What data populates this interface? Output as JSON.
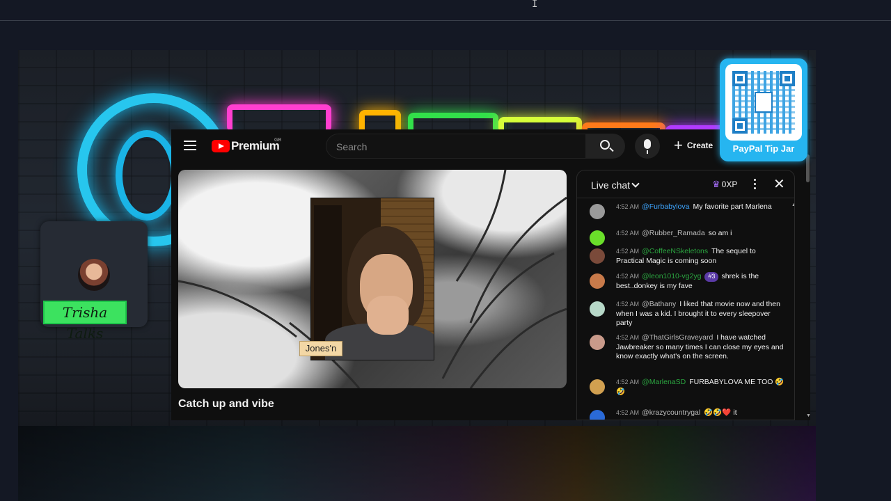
{
  "top": {
    "cursor": "I"
  },
  "overlay": {
    "avatar_name": "Trisha Talks",
    "tip_jar_label": "PayPal Tip Jar"
  },
  "youtube": {
    "brand": "Premium",
    "country": "GB",
    "search_placeholder": "Search",
    "create_label": "Create",
    "video_title": "Catch up and vibe",
    "facecam_label": "Jones'n"
  },
  "chat": {
    "title": "Live chat",
    "xp": "0XP",
    "messages": [
      {
        "time": "4:52 AM",
        "user": "@Furbabylova",
        "text": "My favorite part Marlena",
        "user_color": "blue",
        "avatar": "#9a9a9a"
      },
      {
        "time": "4:52 AM",
        "user": "@Rubber_Ramada",
        "text": "so am i",
        "user_color": "gray",
        "avatar": "#6adf2a"
      },
      {
        "time": "4:52 AM",
        "user": "@CoffeeNSkeletons",
        "text": "The sequel to Practical Magic is coming soon",
        "user_color": "green",
        "avatar": "#7a4a3a"
      },
      {
        "time": "4:52 AM",
        "user": "@leon1010-vg2yg",
        "badge": "#3",
        "text": "shrek is the best..donkey is my fave",
        "user_color": "green",
        "avatar": "#c87a4a"
      },
      {
        "time": "4:52 AM",
        "user": "@Bathany",
        "text": "I liked that movie now and then when I was a kid. I brought it to every sleepover party",
        "user_color": "gray",
        "avatar": "#b7d8c8"
      },
      {
        "time": "4:52 AM",
        "user": "@ThatGirlsGraveyard",
        "text": "I have watched Jawbreaker so many times I can close my eyes and know exactly what's on the screen.",
        "user_color": "gray",
        "avatar": "#c99a8a"
      },
      {
        "time": "4:52 AM",
        "user": "@MarlenaSD",
        "text": "FURBABYLOVA ME TOO 🤣🤣",
        "user_color": "green",
        "avatar": "#d1a050"
      },
      {
        "time": "4:52 AM",
        "user": "@krazycountrygal",
        "text": "🤣🤣❤️ it",
        "user_color": "gray",
        "avatar": "#2a6ad8"
      }
    ]
  },
  "colors": {
    "accent_blue": "#3ea6ff",
    "accent_green": "#2ba640",
    "youtube_red": "#ff0000",
    "tag_green": "#3ce25f",
    "qr_blue": "#26b5f0"
  }
}
